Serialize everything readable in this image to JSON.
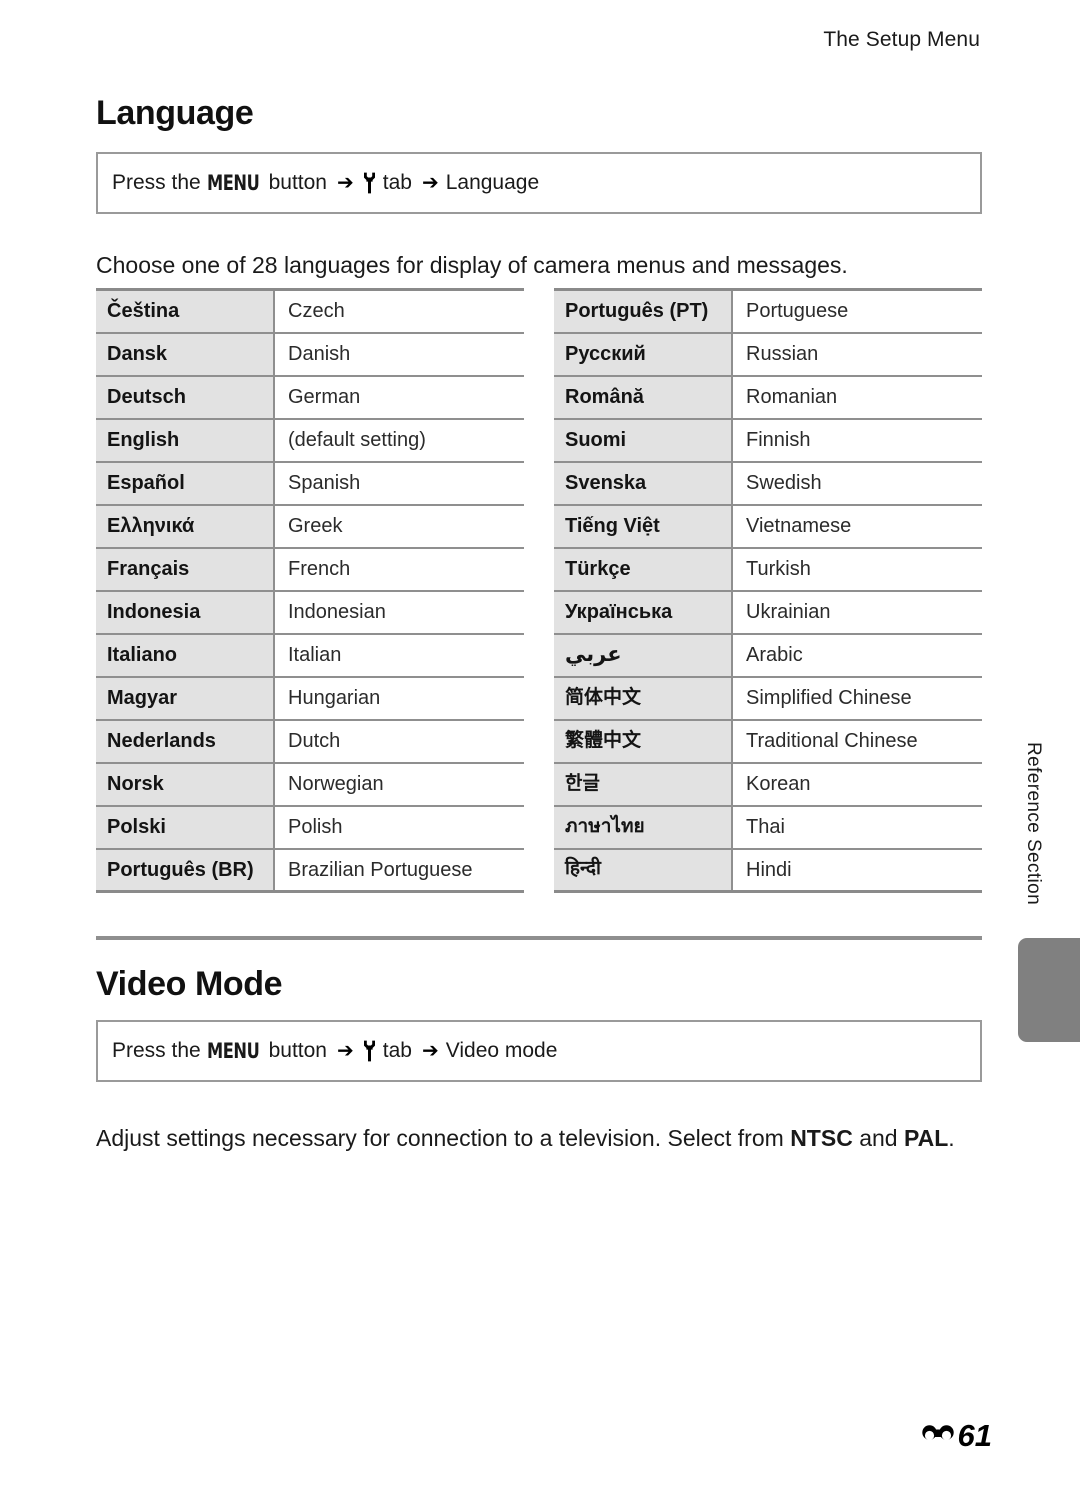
{
  "header": {
    "running_head": "The Setup Menu"
  },
  "sections": {
    "language": {
      "title": "Language",
      "instruction": {
        "prefix": "Press the",
        "menu_button": "MENU",
        "button_word": "button",
        "arrow": "➔",
        "tab_icon": "wrench-icon",
        "tab_word": "tab",
        "arrow2": "➔",
        "target": "Language"
      },
      "intro": "Choose one of 28 languages for display of camera menus and messages.",
      "table_left": [
        {
          "native": "Čeština",
          "english": "Czech"
        },
        {
          "native": "Dansk",
          "english": "Danish"
        },
        {
          "native": "Deutsch",
          "english": "German"
        },
        {
          "native": "English",
          "english": "(default setting)"
        },
        {
          "native": "Español",
          "english": "Spanish"
        },
        {
          "native": "Ελληνικά",
          "english": "Greek"
        },
        {
          "native": "Français",
          "english": "French"
        },
        {
          "native": "Indonesia",
          "english": "Indonesian"
        },
        {
          "native": "Italiano",
          "english": "Italian"
        },
        {
          "native": "Magyar",
          "english": "Hungarian"
        },
        {
          "native": "Nederlands",
          "english": "Dutch"
        },
        {
          "native": "Norsk",
          "english": "Norwegian"
        },
        {
          "native": "Polski",
          "english": "Polish"
        },
        {
          "native": "Português (BR)",
          "english": "Brazilian Portuguese"
        }
      ],
      "table_right": [
        {
          "native": "Português (PT)",
          "english": "Portuguese"
        },
        {
          "native": "Русский",
          "english": "Russian"
        },
        {
          "native": "Română",
          "english": "Romanian"
        },
        {
          "native": "Suomi",
          "english": "Finnish"
        },
        {
          "native": "Svenska",
          "english": "Swedish"
        },
        {
          "native": "Tiếng Việt",
          "english": "Vietnamese"
        },
        {
          "native": "Türkçe",
          "english": "Turkish"
        },
        {
          "native": "Українська",
          "english": "Ukrainian"
        },
        {
          "native": "عربي",
          "english": "Arabic",
          "script": "rtl"
        },
        {
          "native": "简体中文",
          "english": "Simplified Chinese",
          "script": "cjk"
        },
        {
          "native": "繁體中文",
          "english": "Traditional Chinese",
          "script": "cjk"
        },
        {
          "native": "한글",
          "english": "Korean",
          "script": "cjk"
        },
        {
          "native": "ภาษาไทย",
          "english": "Thai",
          "script": "thai"
        },
        {
          "native": "हिन्दी",
          "english": "Hindi",
          "script": "deva"
        }
      ]
    },
    "video_mode": {
      "title": "Video Mode",
      "instruction": {
        "prefix": "Press the",
        "menu_button": "MENU",
        "button_word": "button",
        "arrow": "➔",
        "tab_icon": "wrench-icon",
        "tab_word": "tab",
        "arrow2": "➔",
        "target": "Video mode"
      },
      "body_prefix": "Adjust settings necessary for connection to a television. Select from ",
      "option_ntsc": "NTSC",
      "body_mid": " and ",
      "option_pal": "PAL",
      "body_suffix": "."
    }
  },
  "edge": {
    "tab_label": "Reference Section"
  },
  "footer": {
    "section_symbol": "reference-section-symbol",
    "page_number": "61"
  },
  "colors": {
    "cell_fill": "#e2e2e2",
    "rule": "#8f8f8f",
    "edge_tab": "#808080"
  }
}
